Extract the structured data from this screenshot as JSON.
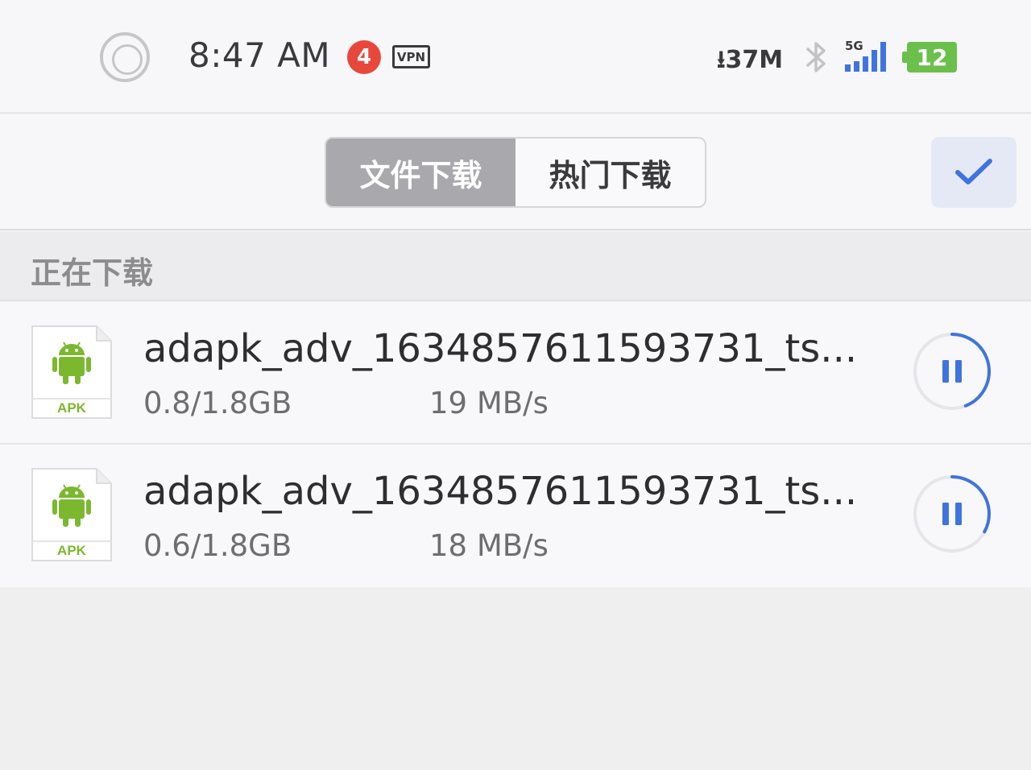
{
  "status_bar": {
    "time": "8:47 AM",
    "notification_count": "4",
    "vpn_label": "VPN",
    "net_speed": "37M",
    "network_type": "5G",
    "battery_level": "12",
    "icons": [
      "home-ring-icon",
      "download-arrow-icon",
      "bluetooth-icon",
      "signal-bars-icon",
      "battery-icon"
    ]
  },
  "header": {
    "tabs": [
      {
        "label": "文件下载",
        "active": true
      },
      {
        "label": "热门下载",
        "active": false
      }
    ],
    "confirm_icon": "checkmark-icon"
  },
  "section": {
    "title": "正在下载"
  },
  "downloads": [
    {
      "icon_label": "APK",
      "name": "adapk_adv_1634857611593731_ts...",
      "size": "0.8/1.8GB",
      "speed": "19 MB/s",
      "progress": 0.44
    },
    {
      "icon_label": "APK",
      "name": "adapk_adv_1634857611593731_ts...",
      "size": "0.6/1.8GB",
      "speed": "18 MB/s",
      "progress": 0.33
    }
  ],
  "colors": {
    "accent_blue": "#3f74e0",
    "android_green": "#7cb82f",
    "battery_green": "#6ac04a",
    "badge_red": "#e8483b",
    "tab_active_bg": "#a9a9ad"
  }
}
